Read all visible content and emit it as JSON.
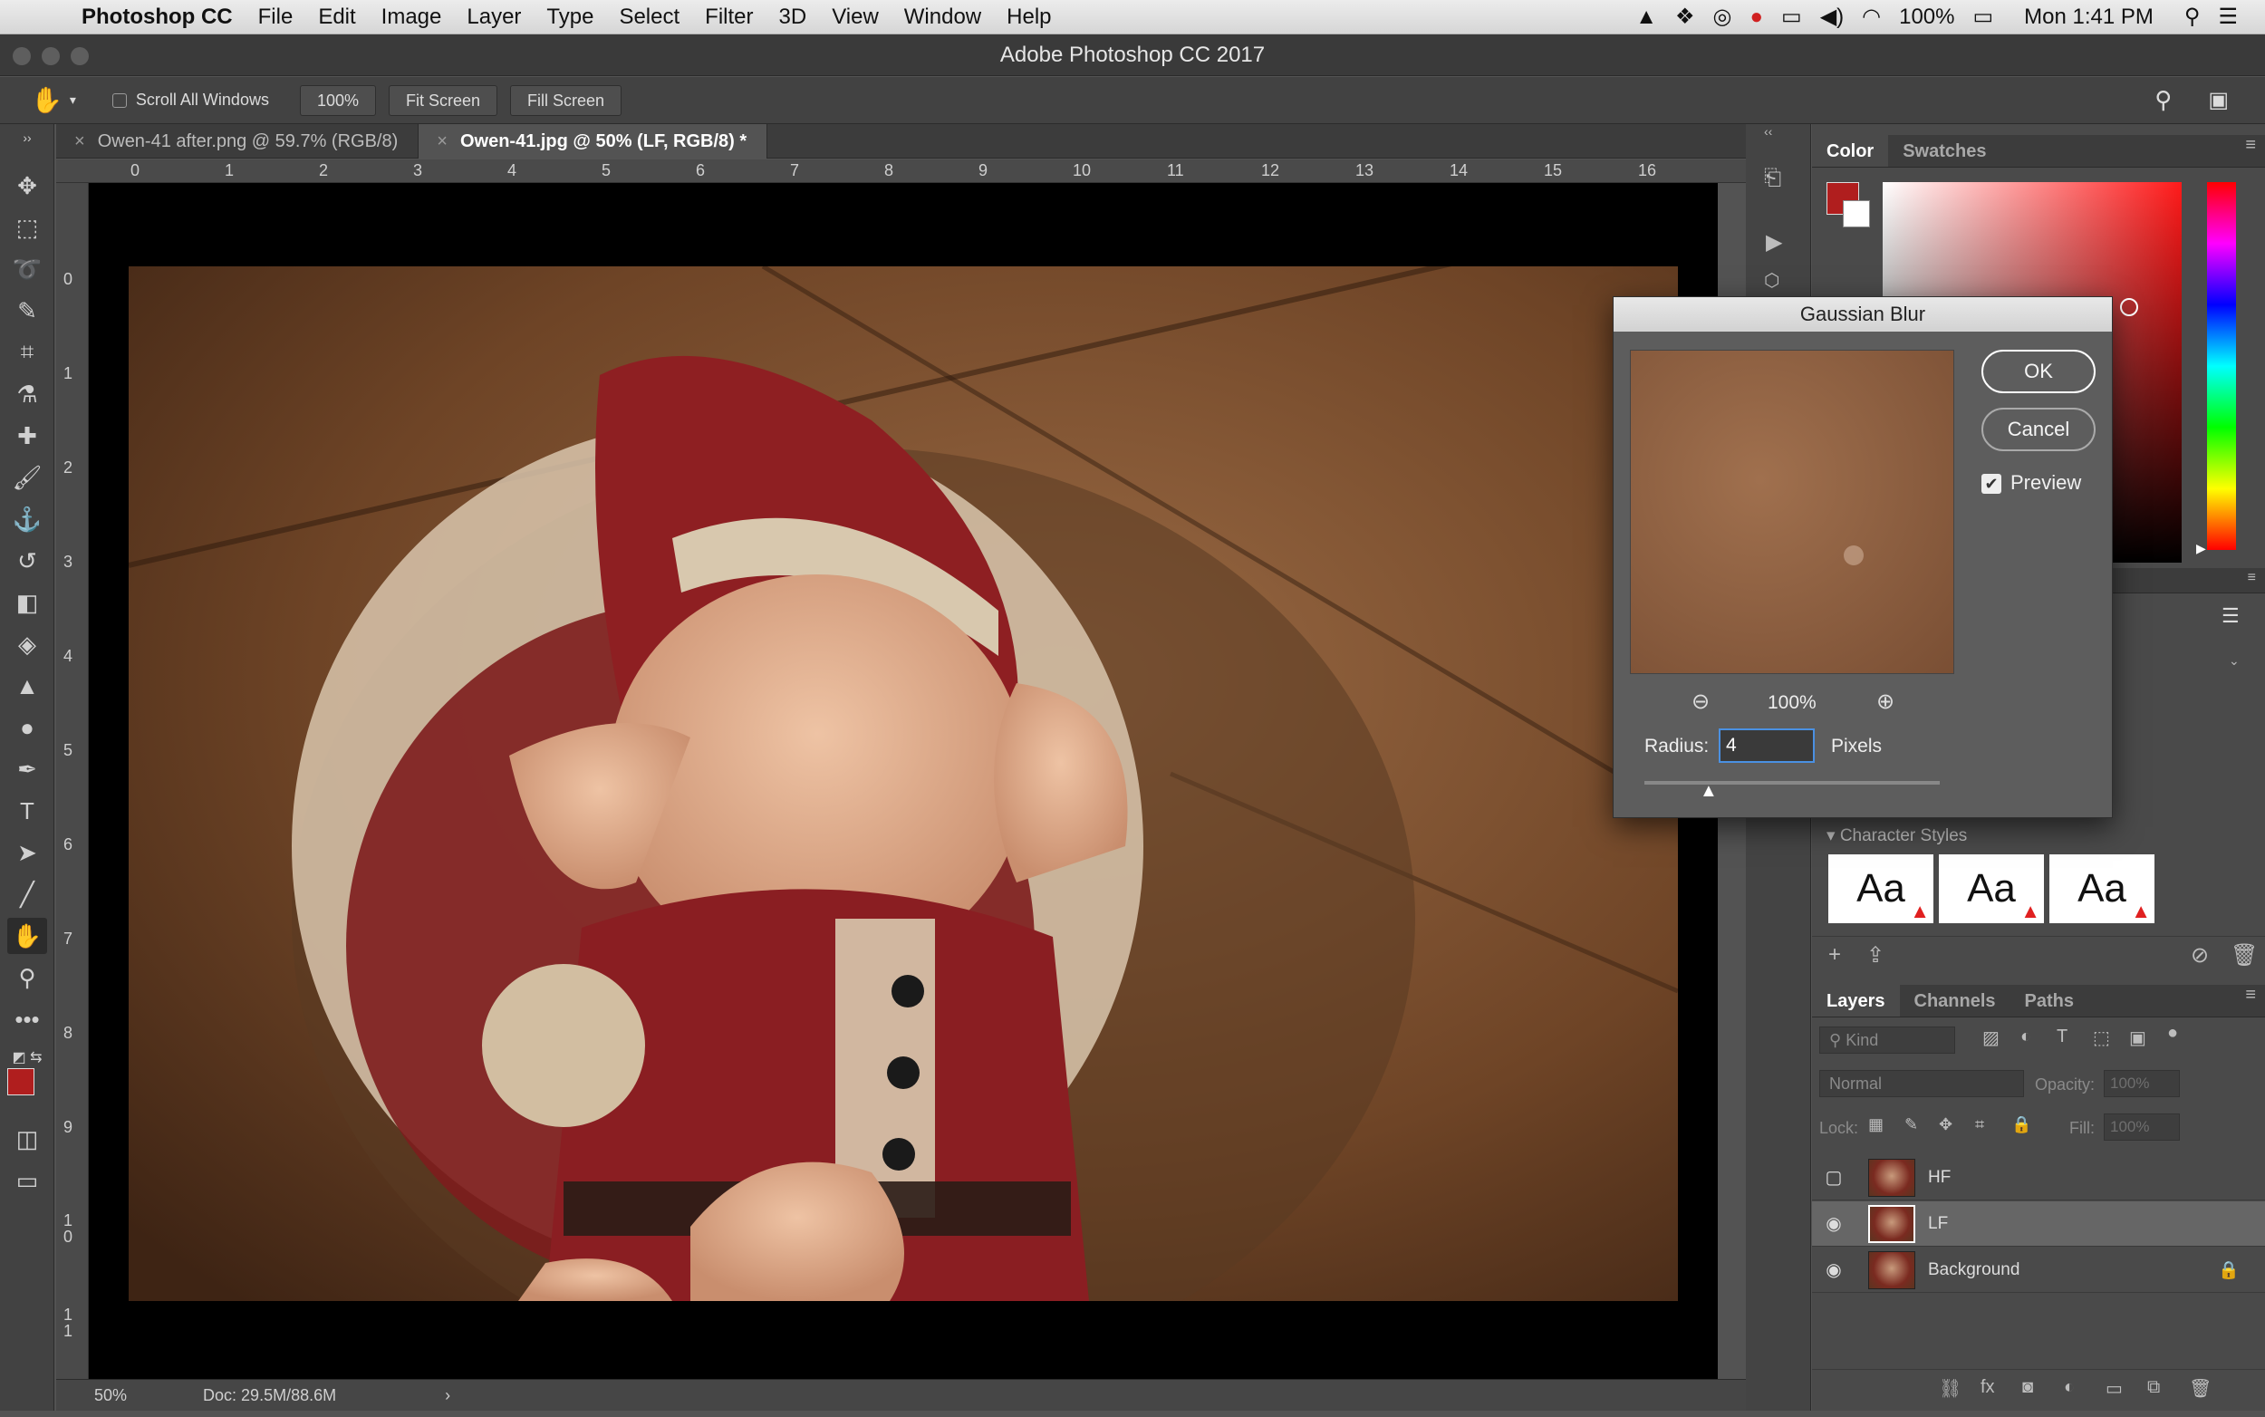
{
  "menubar": {
    "app": "Photoshop CC",
    "items": [
      "File",
      "Edit",
      "Image",
      "Layer",
      "Type",
      "Select",
      "Filter",
      "3D",
      "View",
      "Window",
      "Help"
    ],
    "battery": "100%",
    "clock": "Mon 1:41 PM"
  },
  "window": {
    "title": "Adobe Photoshop CC 2017"
  },
  "options": {
    "scroll_all_label": "Scroll All Windows",
    "zoom_value": "100%",
    "fit_screen": "Fit Screen",
    "fill_screen": "Fill Screen"
  },
  "tabs": [
    {
      "label": "Owen-41 after.png @ 59.7% (RGB/8)"
    },
    {
      "label": "Owen-41.jpg @ 50% (LF, RGB/8) *"
    }
  ],
  "ruler": {
    "h": [
      "0",
      "1",
      "2",
      "3",
      "4",
      "5",
      "6",
      "7",
      "8",
      "9",
      "10",
      "11",
      "12",
      "13",
      "14",
      "15",
      "16"
    ],
    "v": [
      "0",
      "1",
      "2",
      "3",
      "4",
      "5",
      "6",
      "7",
      "8",
      "9",
      "10",
      "11"
    ]
  },
  "status": {
    "zoom": "50%",
    "doc": "Doc: 29.5M/88.6M"
  },
  "color_panel": {
    "tabs": [
      "Color",
      "Swatches"
    ],
    "foreground": "#b01e1e",
    "background": "#ffffff"
  },
  "character_styles": {
    "title": "Character Styles",
    "sample": "Aa"
  },
  "layers_panel": {
    "tabs": [
      "Layers",
      "Channels",
      "Paths"
    ],
    "kind_label": "Kind",
    "blend_mode": "Normal",
    "opacity_label": "Opacity:",
    "opacity_value": "100%",
    "lock_label": "Lock:",
    "fill_label": "Fill:",
    "fill_value": "100%",
    "layers": [
      {
        "name": "HF",
        "visible": false
      },
      {
        "name": "LF",
        "visible": true,
        "selected": true
      },
      {
        "name": "Background",
        "visible": true,
        "locked": true
      }
    ]
  },
  "dialog": {
    "title": "Gaussian Blur",
    "ok": "OK",
    "cancel": "Cancel",
    "preview_label": "Preview",
    "zoom": "100%",
    "radius_label": "Radius:",
    "radius_value": "4",
    "unit": "Pixels"
  }
}
